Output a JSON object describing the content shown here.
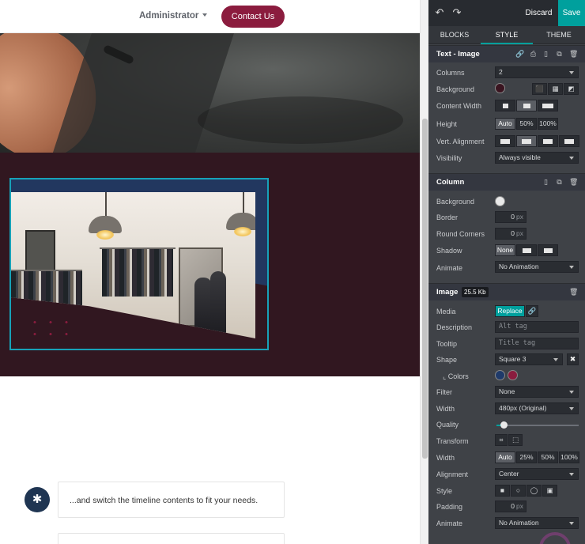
{
  "website": {
    "nav": {
      "admin_label": "Administrator",
      "contact_label": "Contact Us"
    },
    "timeline": {
      "badge_glyph": "✱",
      "text": "...and switch the timeline contents to fit your needs."
    },
    "colors": {
      "brand": "#8b1c3e",
      "dark_section": "#311720",
      "selection": "#17a2b8"
    }
  },
  "editor": {
    "top": {
      "undo_icon": "↶",
      "redo_icon": "↷",
      "discard_label": "Discard",
      "save_label": "Save"
    },
    "tabs": {
      "blocks": "BLOCKS",
      "style": "STYLE",
      "theme": "THEME",
      "active": "STYLE"
    },
    "text_image": {
      "title": "Text - Image",
      "icons": {
        "link": "🔗",
        "save": "⎙",
        "mobile": "▯",
        "copy": "⧉",
        "delete": "🗑"
      },
      "columns": {
        "label": "Columns",
        "value": "2"
      },
      "background": {
        "label": "Background",
        "color": "#3a1420"
      },
      "content_width": {
        "label": "Content Width"
      },
      "height": {
        "label": "Height",
        "auto": "Auto",
        "half": "50%",
        "full": "100%"
      },
      "vert_alignment": {
        "label": "Vert. Alignment"
      },
      "visibility": {
        "label": "Visibility",
        "value": "Always visible"
      }
    },
    "column": {
      "title": "Column",
      "icons": {
        "mobile": "▯",
        "copy": "⧉",
        "delete": "🗑"
      },
      "background": {
        "label": "Background"
      },
      "border": {
        "label": "Border",
        "value": "0",
        "unit": "px"
      },
      "round_corners": {
        "label": "Round Corners",
        "value": "0",
        "unit": "px"
      },
      "shadow": {
        "label": "Shadow",
        "none": "None"
      },
      "animate": {
        "label": "Animate",
        "value": "No Animation"
      }
    },
    "image": {
      "title": "Image",
      "size": "25.5 Kb",
      "icons": {
        "delete": "🗑"
      },
      "media": {
        "label": "Media",
        "replace": "Replace",
        "link_icon": "🔗"
      },
      "description": {
        "label": "Description",
        "placeholder": "Alt tag"
      },
      "tooltip": {
        "label": "Tooltip",
        "placeholder": "Title tag"
      },
      "shape": {
        "label": "Shape",
        "value": "Square 3",
        "clear": "✖"
      },
      "colors": {
        "label": "⌞ Colors",
        "color1": "#1f3a6a",
        "color2": "#8b1c3e"
      },
      "filter": {
        "label": "Filter",
        "value": "None"
      },
      "width_select": {
        "label": "Width",
        "value": "480px (Original)"
      },
      "quality": {
        "label": "Quality",
        "value": 0.08
      },
      "transform": {
        "label": "Transform"
      },
      "width_buttons": {
        "label": "Width",
        "auto": "Auto",
        "p25": "25%",
        "p50": "50%",
        "p100": "100%"
      },
      "alignment": {
        "label": "Alignment",
        "value": "Center"
      },
      "style": {
        "label": "Style"
      },
      "padding": {
        "label": "Padding",
        "value": "0",
        "unit": "px"
      },
      "animate": {
        "label": "Animate",
        "value": "No Animation"
      }
    }
  }
}
